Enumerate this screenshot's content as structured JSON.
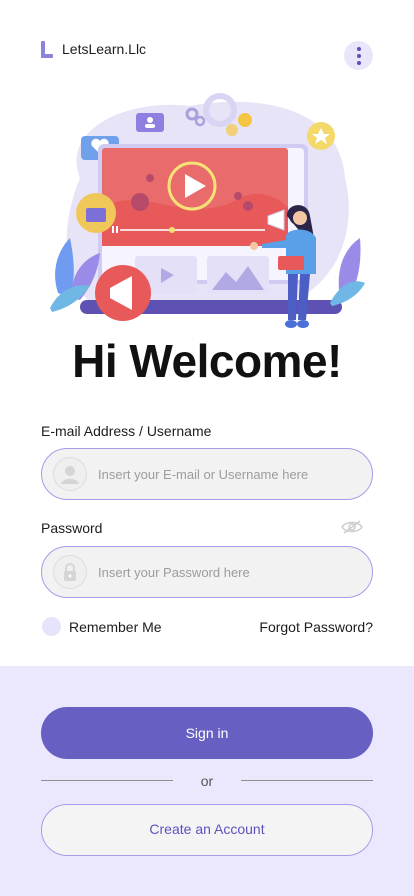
{
  "brand": {
    "name": "LetsLearn.Llc",
    "accent": "#675fc2",
    "icon": "l-logo-icon"
  },
  "header": {
    "menu_icon": "more-vertical-icon"
  },
  "hero": {
    "illustration": "online-learning-illustration"
  },
  "title": "Hi Welcome!",
  "email": {
    "label": "E-mail Address / Username",
    "placeholder": "Insert your E-mail or Username here",
    "value": "",
    "icon": "user-avatar-icon"
  },
  "password": {
    "label": "Password",
    "placeholder": "Insert your Password here",
    "value": "",
    "icon": "lock-icon",
    "visibility_icon": "eye-off-icon"
  },
  "remember": {
    "label": "Remember Me",
    "checked": false
  },
  "forgot": {
    "label": "Forgot Password?"
  },
  "actions": {
    "signin_label": "Sign in",
    "or_label": "or",
    "create_label": "Create an Account"
  },
  "colors": {
    "primary": "#675fc2",
    "field_border": "#a59ce8",
    "bottom_panel": "#ebe8fd",
    "menu_bg": "#e9e6fb"
  }
}
